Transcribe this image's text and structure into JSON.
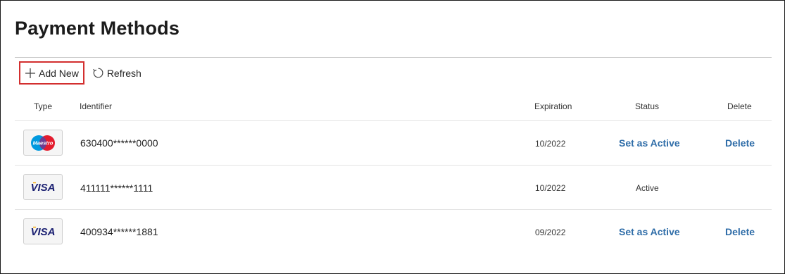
{
  "page": {
    "title": "Payment Methods"
  },
  "toolbar": {
    "add_label": "Add New",
    "refresh_label": "Refresh"
  },
  "table": {
    "headers": {
      "type": "Type",
      "identifier": "Identifier",
      "expiration": "Expiration",
      "status": "Status",
      "delete": "Delete"
    },
    "rows": [
      {
        "card_brand": "maestro-card-icon",
        "brand_text": "Maestro",
        "identifier": "630400******0000",
        "expiration": "10/2022",
        "status": "Set as Active",
        "status_is_link": true,
        "delete_label": "Delete"
      },
      {
        "card_brand": "visa-card-icon",
        "brand_text": "VISA",
        "identifier": "411111******1111",
        "expiration": "10/2022",
        "status": "Active",
        "status_is_link": false,
        "delete_label": ""
      },
      {
        "card_brand": "visa-card-icon",
        "brand_text": "VISA",
        "identifier": "400934******1881",
        "expiration": "09/2022",
        "status": "Set as Active",
        "status_is_link": true,
        "delete_label": "Delete"
      }
    ]
  },
  "colors": {
    "link": "#2f6da8",
    "add_button_border": "#d32f2f",
    "maestro_blue": "#0099df",
    "maestro_red": "#e31c2e",
    "visa_blue": "#1a1f71",
    "visa_gold": "#f7a600"
  }
}
